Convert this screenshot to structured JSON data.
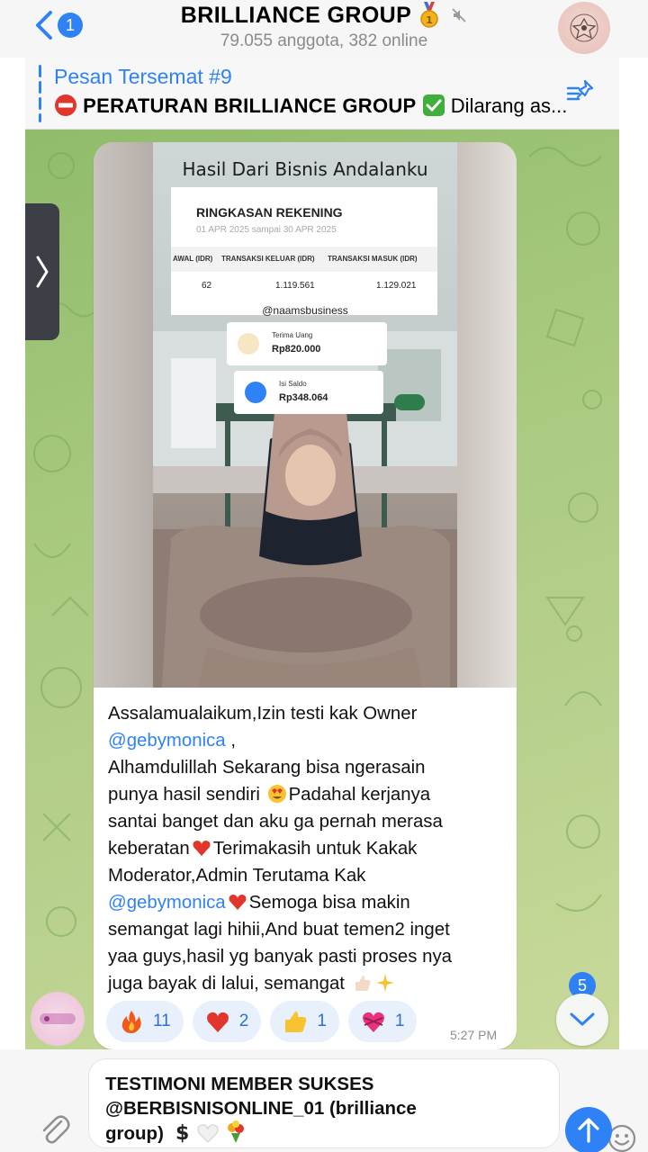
{
  "header": {
    "back_badge": "1",
    "title": "BRILLIANCE GROUP",
    "subtitle": "79.055 anggota, 382 online"
  },
  "pinned": {
    "title": "Pesan Tersemat #9",
    "text_bold": "PERATURAN BRILLIANCE GROUP",
    "text_rest": "Dilarang as..."
  },
  "message": {
    "image": {
      "overlay_title": "Hasil Dari Bisnis Andalanku",
      "account_title": "RINGKASAN REKENING",
      "account_period": "01 APR 2025 sampai 30 APR 2025",
      "columns": [
        "AWAL (IDR)",
        "TRANSAKSI KELUAR (IDR)",
        "TRANSAKSI MASUK (IDR)"
      ],
      "values": [
        "62",
        "1.119.561",
        "1.129.021"
      ],
      "handle": "@naamsbusiness",
      "card1_label": "Terima Uang",
      "card1_value": "Rp820.000",
      "card2_label": "Isi Saldo",
      "card2_value": "Rp348.064"
    },
    "text": {
      "l1": "Assalamualaikum,Izin testi kak Owner",
      "mention1": "@gebymonica",
      "after_mention1": " ,",
      "l3": "Alhamdulillah Sekarang bisa ngerasain",
      "l4": "punya hasil sendiri",
      "l5": "Padahal kerjanya",
      "l6": "santai banget dan aku ga pernah merasa",
      "l7a": "keberatan",
      "l7b": "Terimakasih untuk Kakak",
      "l8": "Moderator,Admin Terutama Kak",
      "mention2": "@gebymonica",
      "l9b": "Semoga bisa makin",
      "l10": "semangat lagi hihii,And buat temen2 inget",
      "l11": "yaa guys,hasil yg banyak pasti proses nya",
      "l12": "juga bayak di lalui, semangat"
    },
    "reactions": [
      {
        "emoji": "fire-emoji",
        "count": "11"
      },
      {
        "emoji": "heart-emoji",
        "count": "2"
      },
      {
        "emoji": "thumbs-up-emoji",
        "count": "1"
      },
      {
        "emoji": "heart-ribbon-emoji",
        "count": "1"
      }
    ],
    "time": "5:27 PM"
  },
  "scroll_badge": "5",
  "composer": {
    "line1": "TESTIMONI MEMBER SUKSES",
    "line2": "@BERBISNISONLINE_01 (brilliance",
    "line3": "group)"
  },
  "colors": {
    "accent": "#2f82f5",
    "reaction_bg": "#e7f0fb",
    "chat_bg": "#a7c87f"
  }
}
